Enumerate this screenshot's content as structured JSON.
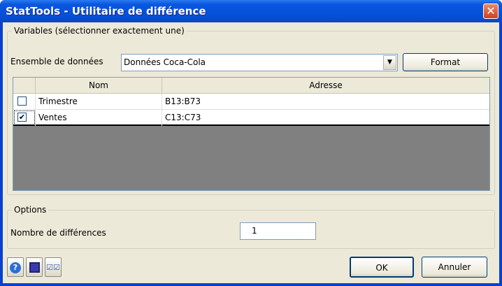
{
  "window": {
    "title": "StatTools - Utilitaire de différence",
    "close_label": "✕"
  },
  "variables": {
    "group_label": "Variables (sélectionner exactement une)",
    "dataset_label": "Ensemble de données",
    "dataset_value": "Données Coca-Cola",
    "format_label": "Format",
    "columns": [
      "Nom",
      "Adresse"
    ],
    "rows": [
      {
        "checked": false,
        "name": "Trimestre",
        "address": "B13:B73"
      },
      {
        "checked": true,
        "name": "Ventes",
        "address": "C13:C73"
      }
    ]
  },
  "options": {
    "group_label": "Options",
    "differences_label": "Nombre de différences",
    "differences_value": "1"
  },
  "footer": {
    "ok_label": "OK",
    "cancel_label": "Annuler",
    "icons": [
      "help-icon",
      "save-icon",
      "select-all-icon"
    ]
  }
}
